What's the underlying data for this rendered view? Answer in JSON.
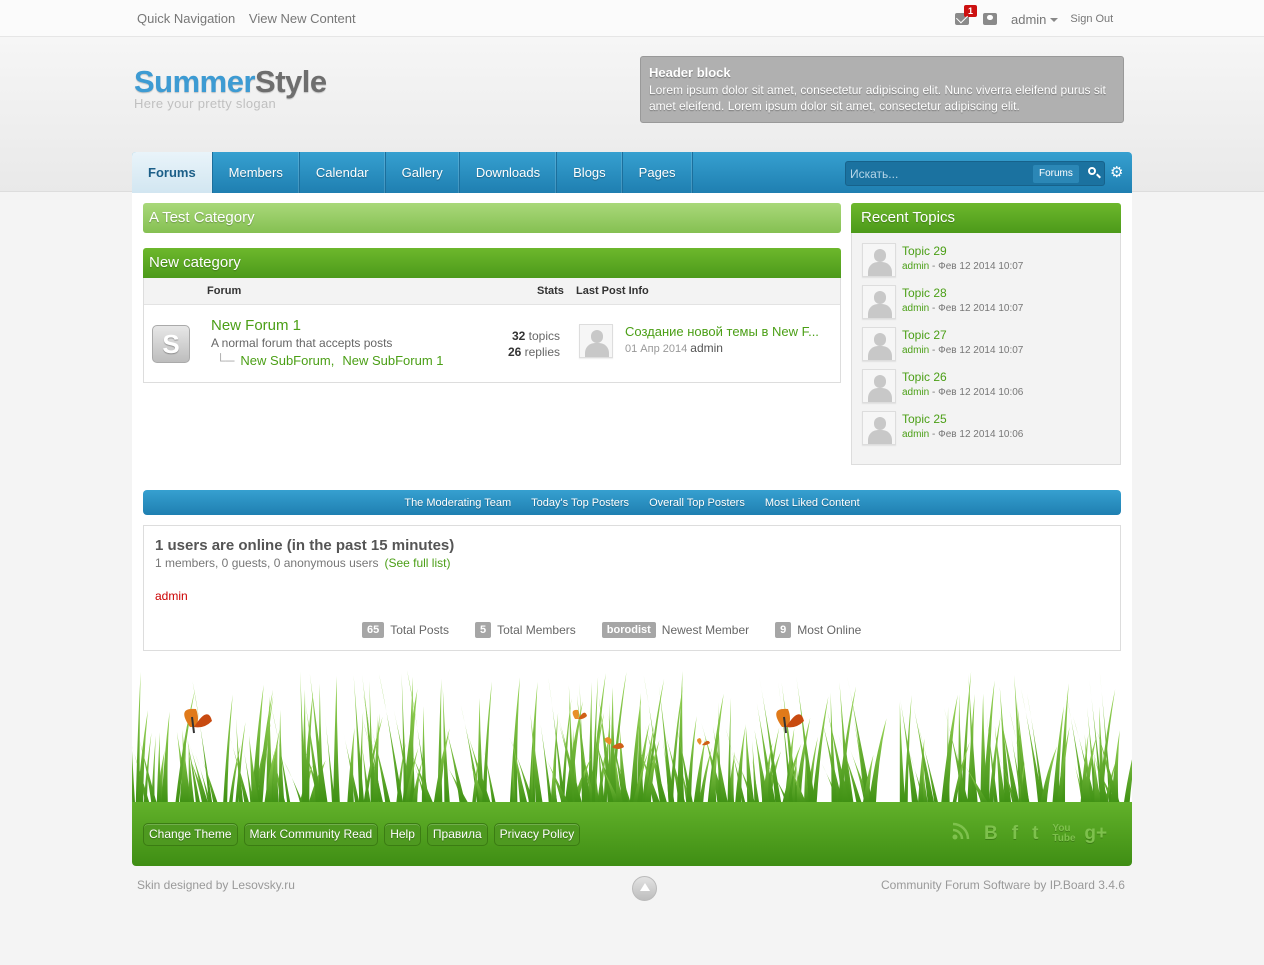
{
  "topbar": {
    "quick_nav": "Quick Navigation",
    "view_new": "View New Content",
    "notif_count": "1",
    "user": "admin",
    "sign_out": "Sign Out"
  },
  "logo": {
    "part1": "Summer",
    "part2": "Style",
    "slogan": "Here your pretty slogan"
  },
  "header_block": {
    "title": "Header block",
    "text": "Lorem ipsum dolor sit amet, consectetur adipiscing elit. Nunc viverra eleifend purus sit amet eleifend. Lorem ipsum dolor sit amet, consectetur adipiscing elit."
  },
  "nav": {
    "tabs": [
      {
        "label": "Forums"
      },
      {
        "label": "Members"
      },
      {
        "label": "Calendar"
      },
      {
        "label": "Gallery"
      },
      {
        "label": "Downloads"
      },
      {
        "label": "Blogs"
      },
      {
        "label": "Pages"
      }
    ],
    "search_placeholder": "Искать...",
    "search_scope": "Forums"
  },
  "categories": {
    "cat1": "A Test Category",
    "cat2": "New category"
  },
  "forum_table": {
    "col_forum": "Forum",
    "col_stats": "Stats",
    "col_last": "Last Post Info",
    "icon_letter": "S",
    "forum": {
      "name": "New Forum 1",
      "desc": "A normal forum that accepts posts",
      "subforums": [
        "New SubForum,",
        "New SubForum 1"
      ],
      "topics_num": "32",
      "topics_label": "topics",
      "replies_num": "26",
      "replies_label": "replies",
      "last_title": "Создание новой темы в New F...",
      "last_date": "01 Апр 2014",
      "last_author": "admin"
    }
  },
  "recent": {
    "title": "Recent Topics",
    "items": [
      {
        "title": "Topic 29",
        "author": "admin",
        "date": " - Фев 12 2014 10:07"
      },
      {
        "title": "Topic 28",
        "author": "admin",
        "date": " - Фев 12 2014 10:07"
      },
      {
        "title": "Topic 27",
        "author": "admin",
        "date": " - Фев 12 2014 10:07"
      },
      {
        "title": "Topic 26",
        "author": "admin",
        "date": " - Фев 12 2014 10:06"
      },
      {
        "title": "Topic 25",
        "author": "admin",
        "date": " - Фев 12 2014 10:06"
      }
    ]
  },
  "stats_tabs": [
    "The Moderating Team",
    "Today's Top Posters",
    "Overall Top Posters",
    "Most Liked Content"
  ],
  "online": {
    "title": "1 users are online (in the past 15 minutes)",
    "sub": "1 members, 0 guests, 0 anonymous users",
    "full_list": "(See full list)",
    "user": "admin",
    "stats": [
      {
        "value": "65",
        "label": "Total Posts"
      },
      {
        "value": "5",
        "label": "Total Members"
      },
      {
        "value": "borodist",
        "label": "Newest Member"
      },
      {
        "value": "9",
        "label": "Most Online"
      }
    ]
  },
  "footer": {
    "links": [
      "Change Theme",
      "Mark Community Read",
      "Help",
      "Правила",
      "Privacy Policy"
    ],
    "social": {
      "blogger": "B",
      "facebook": "f",
      "twitter": "t",
      "youtube": "You Tube",
      "gplus": "g+"
    },
    "credit_left": "Skin designed by Lesovsky.ru",
    "credit_right": "Community Forum Software by IP.Board 3.4.6"
  },
  "colors": {
    "brand_blue": "#2a8fc2",
    "brand_green": "#4c9a1a",
    "link_green": "#4b9f16",
    "online_red": "#cc0000"
  }
}
